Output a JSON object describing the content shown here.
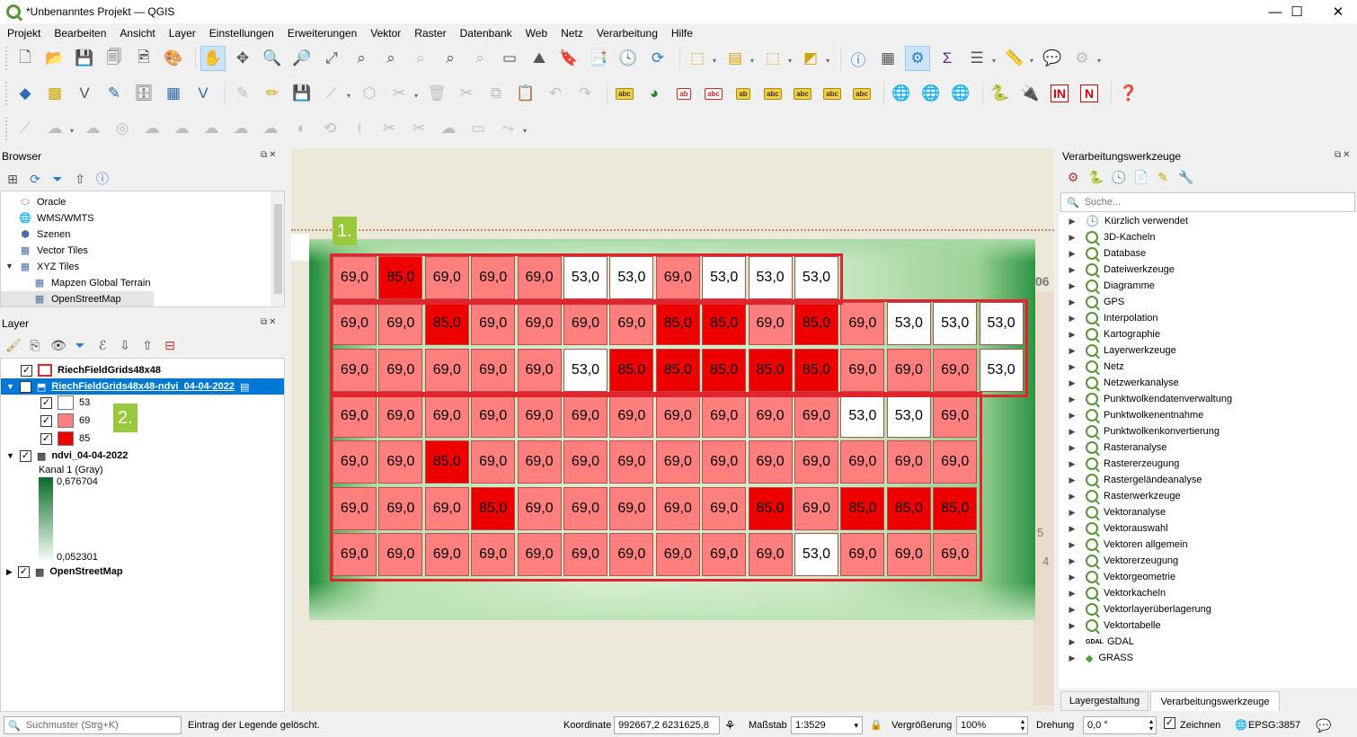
{
  "window": {
    "title": "*Unbenanntes Projekt — QGIS",
    "minimize": "—",
    "maximize": "☐",
    "close": "✕"
  },
  "menu": [
    "Projekt",
    "Bearbeiten",
    "Ansicht",
    "Layer",
    "Einstellungen",
    "Erweiterungen",
    "Vektor",
    "Raster",
    "Datenbank",
    "Web",
    "Netz",
    "Verarbeitung",
    "Hilfe"
  ],
  "browser": {
    "title": "Browser",
    "items": [
      {
        "label": "Oracle",
        "icon": "oracle-icon"
      },
      {
        "label": "WMS/WMTS",
        "icon": "globe-icon"
      },
      {
        "label": "Szenen",
        "icon": "scene-icon"
      },
      {
        "label": "Vector Tiles",
        "icon": "grid-icon"
      },
      {
        "label": "XYZ Tiles",
        "icon": "grid-icon"
      },
      {
        "label": "Mapzen Global Terrain",
        "icon": "grid-icon"
      },
      {
        "label": "OpenStreetMap",
        "icon": "grid-icon"
      }
    ]
  },
  "layers": {
    "title": "Layer",
    "items": [
      {
        "name": "RiechFieldGrids48x48"
      },
      {
        "name": "RiechFieldGrids48x48-ndvi_04-04-2022"
      },
      {
        "name": "ndvi_04-04-2022"
      },
      {
        "name": "OpenStreetMap"
      }
    ],
    "legend": [
      {
        "label": "53",
        "color": "#ffffff"
      },
      {
        "label": "69",
        "color": "#ff7f7f"
      },
      {
        "label": "85",
        "color": "#ee0000"
      }
    ],
    "raster_band": "Kanal 1 (Gray)",
    "raster_max": "0,676704",
    "raster_min": "0,052301"
  },
  "annotations": {
    "one": "1.",
    "two": "2."
  },
  "map_labels": {
    "road_number": "06",
    "edge_5": "5",
    "edge_4": "4"
  },
  "grid": {
    "rows": [
      [
        "69,0",
        "85,0",
        "69,0",
        "69,0",
        "69,0",
        "53,0",
        "53,0",
        "69,0",
        "53,0",
        "53,0",
        "53,0"
      ],
      [
        "69,0",
        "69,0",
        "85,0",
        "69,0",
        "69,0",
        "69,0",
        "69,0",
        "85,0",
        "85,0",
        "69,0",
        "85,0",
        "69,0",
        "53,0",
        "53,0",
        "53,0"
      ],
      [
        "69,0",
        "69,0",
        "69,0",
        "69,0",
        "69,0",
        "53,0",
        "85,0",
        "85,0",
        "85,0",
        "85,0",
        "85,0",
        "69,0",
        "69,0",
        "69,0",
        "53,0"
      ],
      [
        "69,0",
        "69,0",
        "69,0",
        "69,0",
        "69,0",
        "69,0",
        "69,0",
        "69,0",
        "69,0",
        "69,0",
        "69,0",
        "53,0",
        "53,0",
        "69,0"
      ],
      [
        "69,0",
        "69,0",
        "85,0",
        "69,0",
        "69,0",
        "69,0",
        "69,0",
        "69,0",
        "69,0",
        "69,0",
        "69,0",
        "69,0",
        "69,0",
        "69,0"
      ],
      [
        "69,0",
        "69,0",
        "69,0",
        "85,0",
        "69,0",
        "69,0",
        "69,0",
        "69,0",
        "69,0",
        "85,0",
        "69,0",
        "85,0",
        "85,0",
        "85,0"
      ],
      [
        "69,0",
        "69,0",
        "69,0",
        "69,0",
        "69,0",
        "69,0",
        "69,0",
        "69,0",
        "69,0",
        "69,0",
        "53,0",
        "69,0",
        "69,0",
        "69,0"
      ]
    ]
  },
  "processing": {
    "title": "Verarbeitungswerkzeuge",
    "search_placeholder": "Suche...",
    "items": [
      "Kürzlich verwendet",
      "3D-Kacheln",
      "Database",
      "Dateiwerkzeuge",
      "Diagramme",
      "GPS",
      "Interpolation",
      "Kartographie",
      "Layerwerkzeuge",
      "Netz",
      "Netzwerkanalyse",
      "Punktwolkendatenverwaltung",
      "Punktwolkenentnahme",
      "Punktwolkenkonvertierung",
      "Rasteranalyse",
      "Rastererzeugung",
      "Rastergeländeanalyse",
      "Rasterwerkzeuge",
      "Vektoranalyse",
      "Vektorauswahl",
      "Vektoren allgemein",
      "Vektorerzeugung",
      "Vektorgeometrie",
      "Vektorkacheln",
      "Vektorlayerüberlagerung",
      "Vektortabelle",
      "GDAL",
      "GRASS"
    ],
    "tabs": [
      "Layergestaltung",
      "Verarbeitungswerkzeuge"
    ]
  },
  "status": {
    "search_placeholder": "Suchmuster (Strg+K)",
    "message": "Eintrag der Legende gelöscht.",
    "coord_label": "Koordinate",
    "coord_value": "992667,2  6231625,8",
    "scale_label": "Maßstab",
    "scale_value": "1:3529",
    "zoom_label": "Vergrößerung",
    "zoom_value": "100%",
    "rotation_label": "Drehung",
    "rotation_value": "0,0 °",
    "render_label": "Zeichnen",
    "crs": "EPSG:3857"
  }
}
